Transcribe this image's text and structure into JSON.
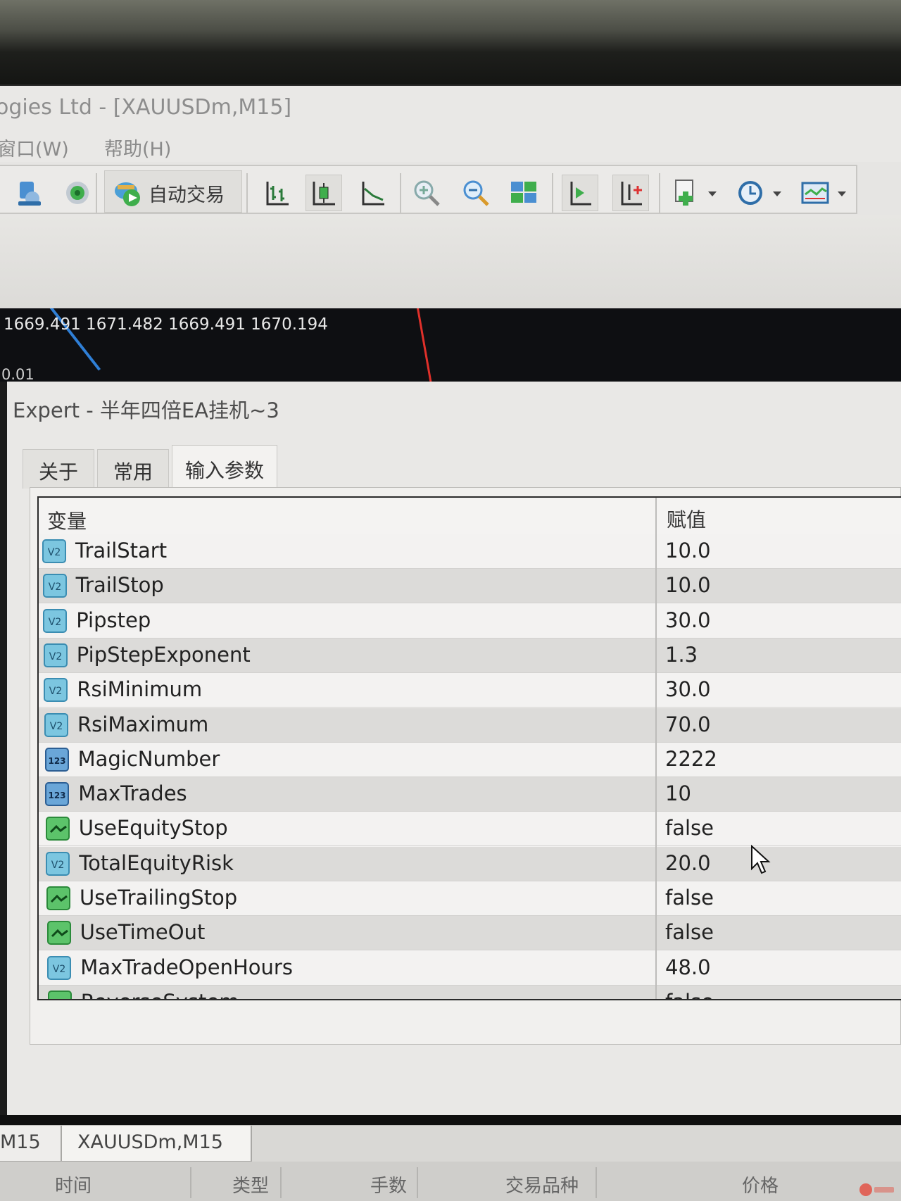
{
  "app": {
    "window_title": "ogies Ltd - [XAUUSDm,M15]",
    "menu": [
      {
        "label": "窗口(W)"
      },
      {
        "label": "帮助(H)"
      }
    ]
  },
  "toolbar": {
    "auto_trade_label": "自动交易",
    "icons": [
      "profiles-icon",
      "signal-icon",
      "auto-trading-icon",
      "bar-chart-icon",
      "candlestick-chart-icon",
      "line-chart-icon",
      "zoom-in-icon",
      "zoom-out-icon",
      "tile-windows-icon",
      "chart-shift-icon",
      "autoscroll-icon",
      "indicators-icon",
      "periods-icon",
      "templates-icon"
    ]
  },
  "chart": {
    "ohlc": "1669.491 1671.482 1669.491 1670.194",
    "volume_label": "0.01"
  },
  "dialog": {
    "title": "Expert - 半年四倍EA挂机~3",
    "tabs": [
      {
        "label": "关于"
      },
      {
        "label": "常用"
      },
      {
        "label": "输入参数",
        "active": true
      }
    ],
    "table": {
      "col_variable": "变量",
      "col_value": "赋值",
      "rows": [
        {
          "name": "TrailStart",
          "value": "10.0",
          "type": "double"
        },
        {
          "name": "TrailStop",
          "value": "10.0",
          "type": "double"
        },
        {
          "name": "Pipstep",
          "value": "30.0",
          "type": "double"
        },
        {
          "name": "PipStepExponent",
          "value": "1.3",
          "type": "double"
        },
        {
          "name": "RsiMinimum",
          "value": "30.0",
          "type": "double"
        },
        {
          "name": "RsiMaximum",
          "value": "70.0",
          "type": "double"
        },
        {
          "name": "MagicNumber",
          "value": "2222",
          "type": "int"
        },
        {
          "name": "MaxTrades",
          "value": "10",
          "type": "int"
        },
        {
          "name": "UseEquityStop",
          "value": "false",
          "type": "bool"
        },
        {
          "name": "TotalEquityRisk",
          "value": "20.0",
          "type": "double"
        },
        {
          "name": "UseTrailingStop",
          "value": "false",
          "type": "bool"
        },
        {
          "name": "UseTimeOut",
          "value": "false",
          "type": "bool"
        },
        {
          "name": "MaxTradeOpenHours",
          "value": "48.0",
          "type": "double"
        },
        {
          "name": "ReverseSystem",
          "value": "false",
          "type": "bool"
        }
      ]
    }
  },
  "window_tabs": [
    {
      "label": "M15"
    },
    {
      "label": "XAUUSDm,M15",
      "active": true
    }
  ],
  "terminal": {
    "columns": [
      "时间",
      "类型",
      "手数",
      "交易品种",
      "价格"
    ]
  },
  "colors": {
    "accent_green": "#3fae4c",
    "accent_blue": "#2f7fd6",
    "chart_bg": "#0e0f12"
  }
}
